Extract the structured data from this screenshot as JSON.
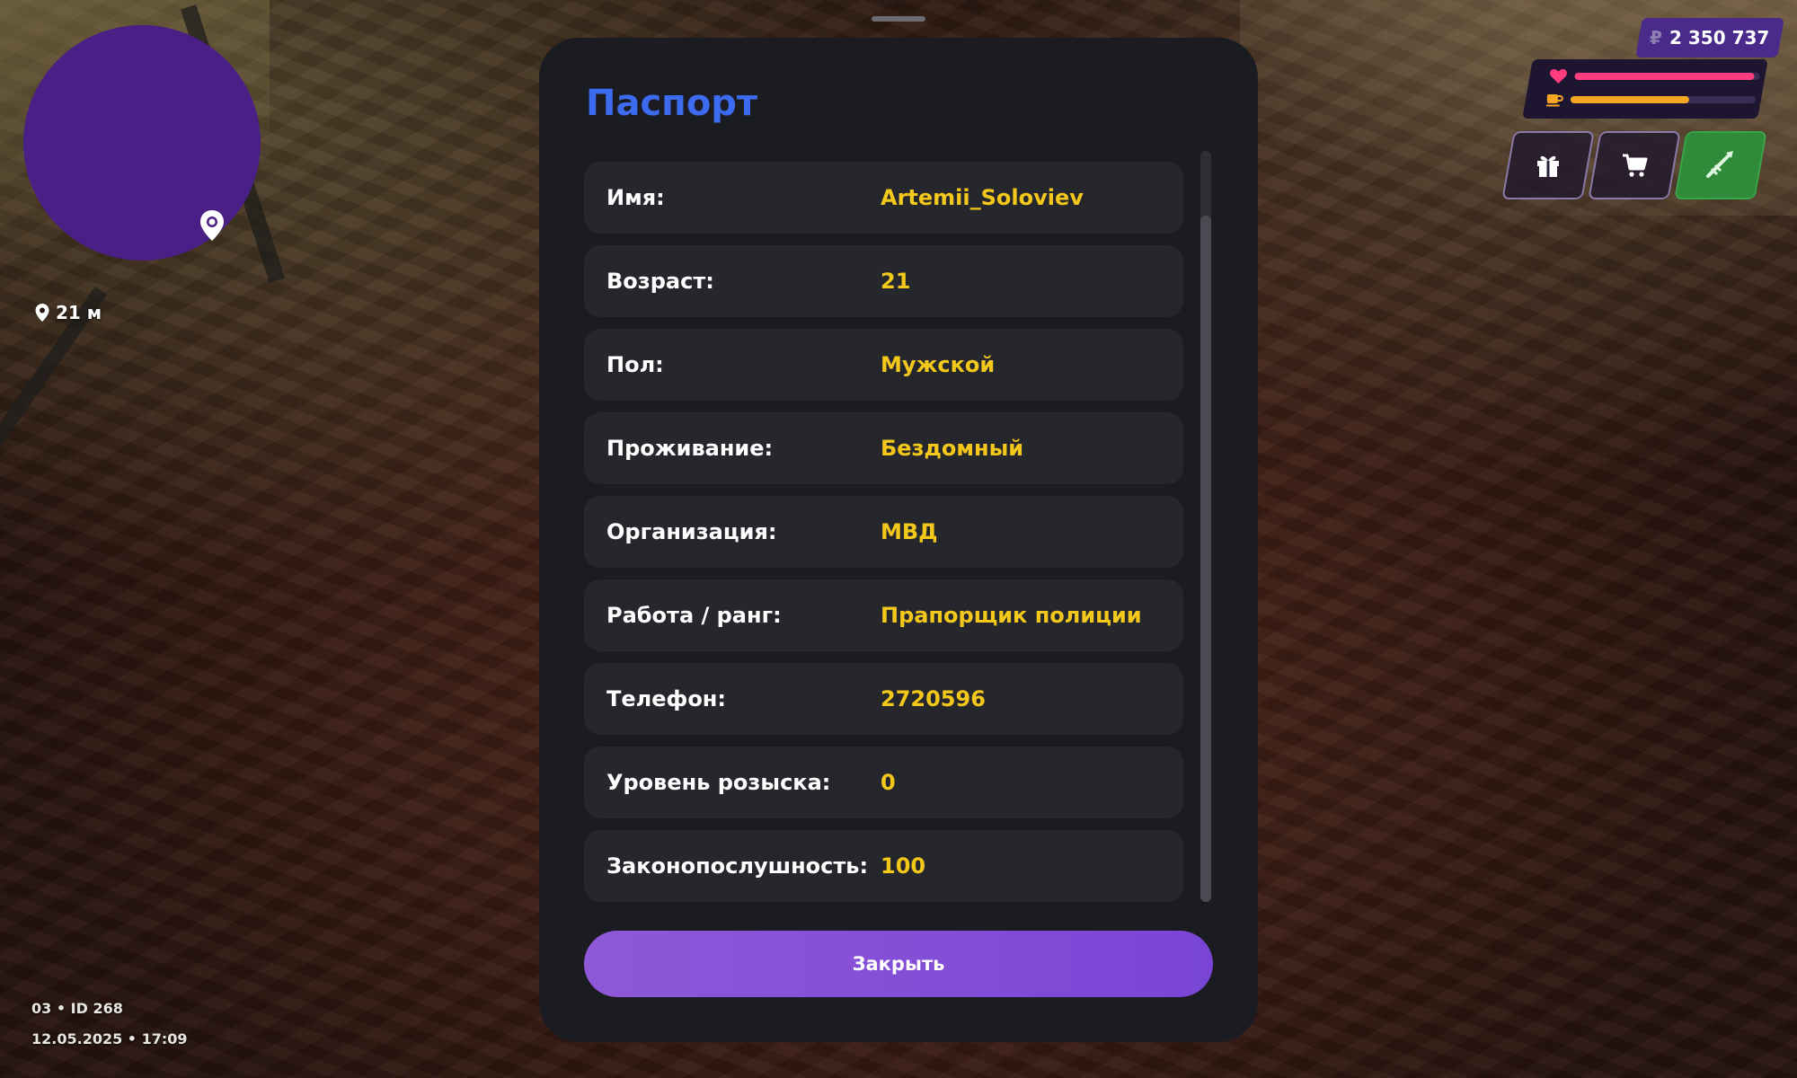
{
  "minimap": {
    "distance": "21 м"
  },
  "server_info": {
    "line1": "03 • ID 268",
    "line2": "12.05.2025 • 17:09"
  },
  "hud": {
    "currency_symbol": "₽",
    "money": "2 350 737",
    "health_level": 0.97,
    "food_level": 0.64,
    "colors": {
      "health": "#ff3d7f",
      "food": "#f5a623"
    },
    "buttons": [
      "gift-icon",
      "cart-icon",
      "weapon-icon"
    ]
  },
  "passport": {
    "title": "Паспорт",
    "rows": [
      {
        "label": "Имя:",
        "value": "Artemii_Soloviev"
      },
      {
        "label": "Возраст:",
        "value": "21"
      },
      {
        "label": "Пол:",
        "value": "Мужской"
      },
      {
        "label": "Проживание:",
        "value": "Бездомный"
      },
      {
        "label": "Организация:",
        "value": "МВД"
      },
      {
        "label": "Работа / ранг:",
        "value": "Прапорщик полиции"
      },
      {
        "label": "Телефон:",
        "value": "2720596"
      },
      {
        "label": "Уровень розыска:",
        "value": "0"
      },
      {
        "label": "Законопослушность:",
        "value": "100"
      }
    ],
    "close_label": "Закрыть"
  }
}
